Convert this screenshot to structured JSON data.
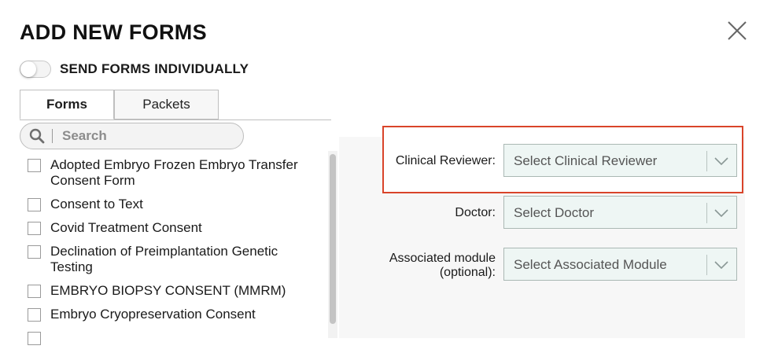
{
  "dialog": {
    "title": "ADD NEW FORMS",
    "toggle_label": "SEND FORMS INDIVIDUALLY",
    "toggle_on": false
  },
  "tabs": [
    {
      "label": "Forms",
      "active": true
    },
    {
      "label": "Packets",
      "active": false
    }
  ],
  "search": {
    "placeholder": "Search"
  },
  "forms": [
    {
      "label": "Adopted Embryo Frozen Embryo Transfer Consent Form",
      "checked": false
    },
    {
      "label": "Consent to Text",
      "checked": false
    },
    {
      "label": "Covid Treatment Consent",
      "checked": false
    },
    {
      "label": "Declination of Preimplantation Genetic Testing",
      "checked": false
    },
    {
      "label": "EMBRYO BIOPSY CONSENT (MMRM)",
      "checked": false
    },
    {
      "label": "Embryo Cryopreservation Consent",
      "checked": false
    }
  ],
  "fields": {
    "clinical_reviewer": {
      "label": "Clinical Reviewer:",
      "placeholder": "Select Clinical Reviewer"
    },
    "doctor": {
      "label": "Doctor:",
      "placeholder": "Select Doctor"
    },
    "associated_module": {
      "label_line1": "Associated module",
      "label_line2": "(optional):",
      "placeholder": "Select Associated Module"
    }
  },
  "colors": {
    "highlight_border": "#d9442a",
    "select_bg": "#eef6f4"
  },
  "icons": {
    "close": "close-icon",
    "search": "search-icon",
    "dropdown": "chevron-down-icon"
  }
}
